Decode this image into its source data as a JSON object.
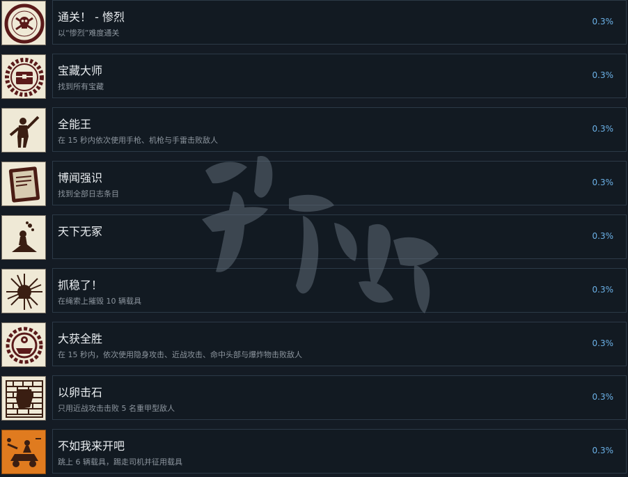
{
  "watermark_text": "游侠网",
  "accent_color": "#6cb2e8",
  "achievements": [
    {
      "title": "通关！ - 惨烈",
      "desc": "以“惨烈”难度通关",
      "percent": "0.3%",
      "icon": "skull-badge-icon"
    },
    {
      "title": "宝藏大师",
      "desc": "找到所有宝藏",
      "percent": "0.3%",
      "icon": "treasure-chest-icon"
    },
    {
      "title": "全能王",
      "desc": "在 15 秒内依次使用手枪、机枪与手雷击败敌人",
      "percent": "0.3%",
      "icon": "gunman-icon"
    },
    {
      "title": "博闻强识",
      "desc": "找到全部日志条目",
      "percent": "0.3%",
      "icon": "journal-icon"
    },
    {
      "title": "天下无冢",
      "desc": "",
      "percent": "0.3%",
      "icon": "dig-icon"
    },
    {
      "title": "抓稳了！",
      "desc": "在绳索上摧毁 10 辆载具",
      "percent": "0.3%",
      "icon": "explosion-icon"
    },
    {
      "title": "大获全胜",
      "desc": "在 15 秒内，依次使用隐身攻击、近战攻击、命中头部与爆炸物击败敌人",
      "percent": "0.3%",
      "icon": "target-gear-icon"
    },
    {
      "title": "以卵击石",
      "desc": "只用近战攻击击败 5 名重甲型敌人",
      "percent": "0.3%",
      "icon": "brick-wall-icon"
    },
    {
      "title": "不如我来开吧",
      "desc": "跳上 6 辆载具，踢走司机并征用载具",
      "percent": "0.3%",
      "icon": "vehicle-hijack-icon"
    }
  ]
}
